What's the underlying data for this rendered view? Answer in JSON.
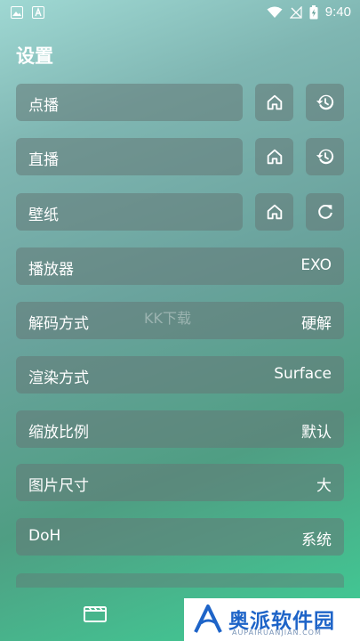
{
  "status": {
    "time": "9:40"
  },
  "page_title": "设置",
  "rows": [
    {
      "label": "点播"
    },
    {
      "label": "直播"
    },
    {
      "label": "壁纸"
    },
    {
      "label": "播放器",
      "value": "EXO"
    },
    {
      "label": "解码方式",
      "value": "硬解"
    },
    {
      "label": "渲染方式",
      "value": "Surface"
    },
    {
      "label": "缩放比例",
      "value": "默认"
    },
    {
      "label": "图片尺寸",
      "value": "大"
    },
    {
      "label": "DoH",
      "value": "系统"
    }
  ],
  "watermark": {
    "text": "KK下载"
  },
  "brand": {
    "name": "奥派软件园",
    "url": "AUPAIRUANJIAN.COM"
  },
  "icons": {
    "home": "home-icon",
    "history": "history-icon",
    "refresh": "refresh-icon",
    "film": "film-icon"
  }
}
